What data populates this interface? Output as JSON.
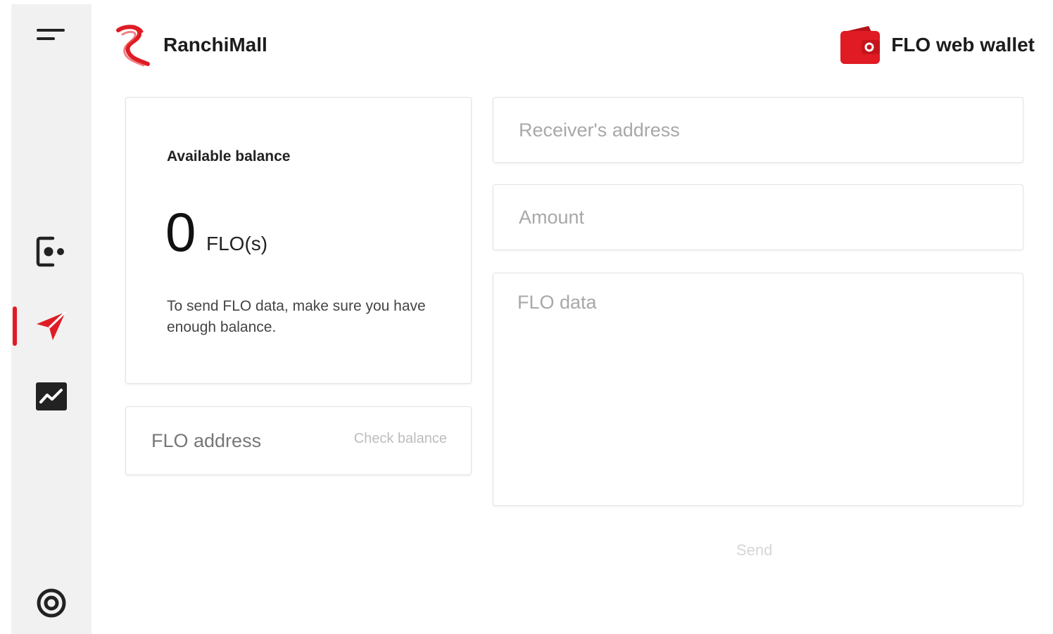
{
  "brand": {
    "name": "RanchiMall",
    "logo_icon": "ranchimall-logo-icon"
  },
  "app": {
    "title": "FLO web wallet",
    "icon": "wallet-icon"
  },
  "colors": {
    "accent": "#e01b24",
    "sidebar_bg": "#f1f1f1"
  },
  "sidebar": {
    "items": [
      {
        "icon": "menu-icon",
        "active": false
      },
      {
        "icon": "contacts-icon",
        "active": false
      },
      {
        "icon": "send-icon",
        "active": true
      },
      {
        "icon": "monitor-chart-icon",
        "active": false
      },
      {
        "icon": "settings-icon",
        "active": false
      }
    ]
  },
  "balance": {
    "label": "Available balance",
    "value": "0",
    "unit": "FLO(s)",
    "note": "To send FLO data, make sure you have enough balance."
  },
  "address_check": {
    "placeholder": "FLO address",
    "button_label": "Check balance"
  },
  "send_form": {
    "receiver_placeholder": "Receiver's address",
    "amount_placeholder": "Amount",
    "data_placeholder": "FLO data",
    "send_label": "Send"
  }
}
